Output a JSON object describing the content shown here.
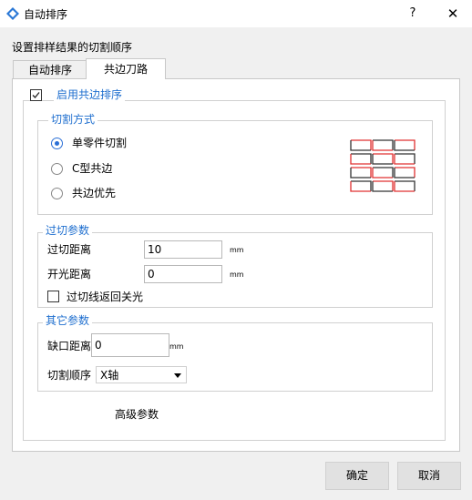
{
  "window": {
    "title": "自动排序",
    "help_glyph": "?",
    "close_glyph": "✕"
  },
  "description": "设置排样结果的切割顺序",
  "tabs": [
    {
      "label": "自动排序",
      "active": false
    },
    {
      "label": "共边刀路",
      "active": true
    }
  ],
  "enable_common_edge": {
    "label": "启用共边排序",
    "checked": true
  },
  "cut_mode": {
    "legend": "切割方式",
    "options": [
      {
        "label": "单零件切割",
        "selected": true
      },
      {
        "label": "C型共边",
        "selected": false
      },
      {
        "label": "共边优先",
        "selected": false
      }
    ]
  },
  "overcut": {
    "legend": "过切参数",
    "overcut_distance": {
      "label": "过切距离",
      "value": "10",
      "unit": "mm"
    },
    "open_light_distance": {
      "label": "开光距离",
      "value": "0",
      "unit": "mm"
    },
    "return_off_light": {
      "label": "过切线返回关光",
      "checked": false
    }
  },
  "other": {
    "legend": "其它参数",
    "gap_distance": {
      "label": "缺口距离",
      "value": "0",
      "unit": "mm"
    },
    "cut_order": {
      "label": "切割顺序",
      "value": "X轴"
    }
  },
  "advanced_label": "高级参数",
  "buttons": {
    "ok": "确定",
    "cancel": "取消"
  },
  "colors": {
    "accent": "#1f6fcf",
    "preview_red": "#e03030",
    "preview_dark": "#333333"
  }
}
